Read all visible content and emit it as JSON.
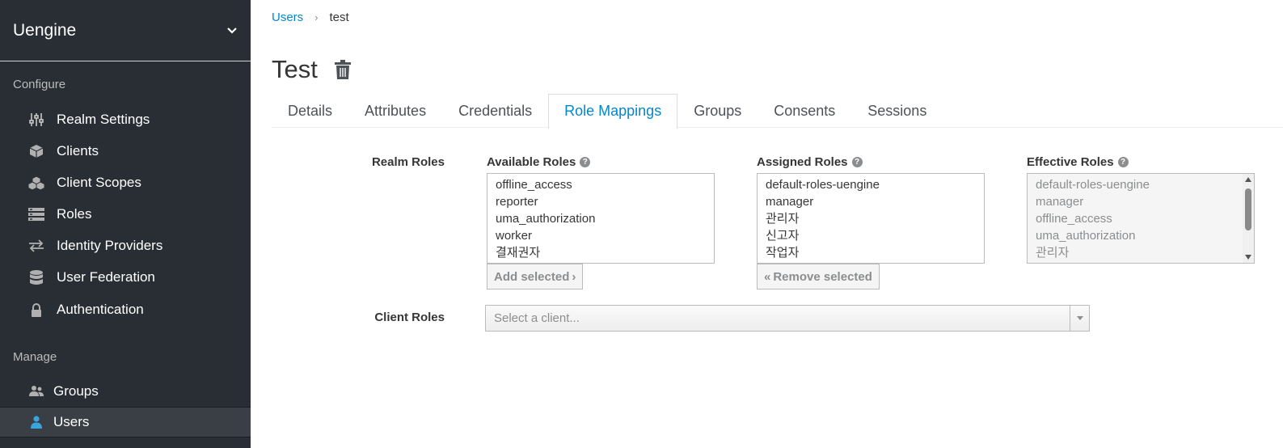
{
  "sidebar": {
    "realm": "Uengine",
    "configure_title": "Configure",
    "configure_items": [
      {
        "label": "Realm Settings",
        "icon": "sliders-icon"
      },
      {
        "label": "Clients",
        "icon": "cube-icon"
      },
      {
        "label": "Client Scopes",
        "icon": "cubes-icon"
      },
      {
        "label": "Roles",
        "icon": "list-icon"
      },
      {
        "label": "Identity Providers",
        "icon": "exchange-icon"
      },
      {
        "label": "User Federation",
        "icon": "database-icon"
      },
      {
        "label": "Authentication",
        "icon": "lock-icon"
      }
    ],
    "manage_title": "Manage",
    "manage_items": [
      {
        "label": "Groups",
        "icon": "users-icon"
      },
      {
        "label": "Users",
        "icon": "user-icon",
        "active": true
      }
    ]
  },
  "breadcrumb": {
    "parent": "Users",
    "current": "test"
  },
  "page": {
    "title": "Test"
  },
  "tabs": [
    "Details",
    "Attributes",
    "Credentials",
    "Role Mappings",
    "Groups",
    "Consents",
    "Sessions"
  ],
  "active_tab": "Role Mappings",
  "realm_roles": {
    "label": "Realm Roles",
    "available": {
      "label": "Available Roles",
      "items": [
        "offline_access",
        "reporter",
        "uma_authorization",
        "worker",
        "결재권자"
      ]
    },
    "assigned": {
      "label": "Assigned Roles",
      "items": [
        "default-roles-uengine",
        "manager",
        "관리자",
        "신고자",
        "작업자"
      ]
    },
    "effective": {
      "label": "Effective Roles",
      "items": [
        "default-roles-uengine",
        "manager",
        "offline_access",
        "uma_authorization",
        "관리자"
      ]
    },
    "add_button": "Add selected",
    "remove_button": "Remove selected"
  },
  "client_roles": {
    "label": "Client Roles",
    "placeholder": "Select a client..."
  },
  "colors": {
    "sidebar_bg": "#292e34",
    "accent": "#0088ce",
    "active_icon": "#39a5dc"
  }
}
